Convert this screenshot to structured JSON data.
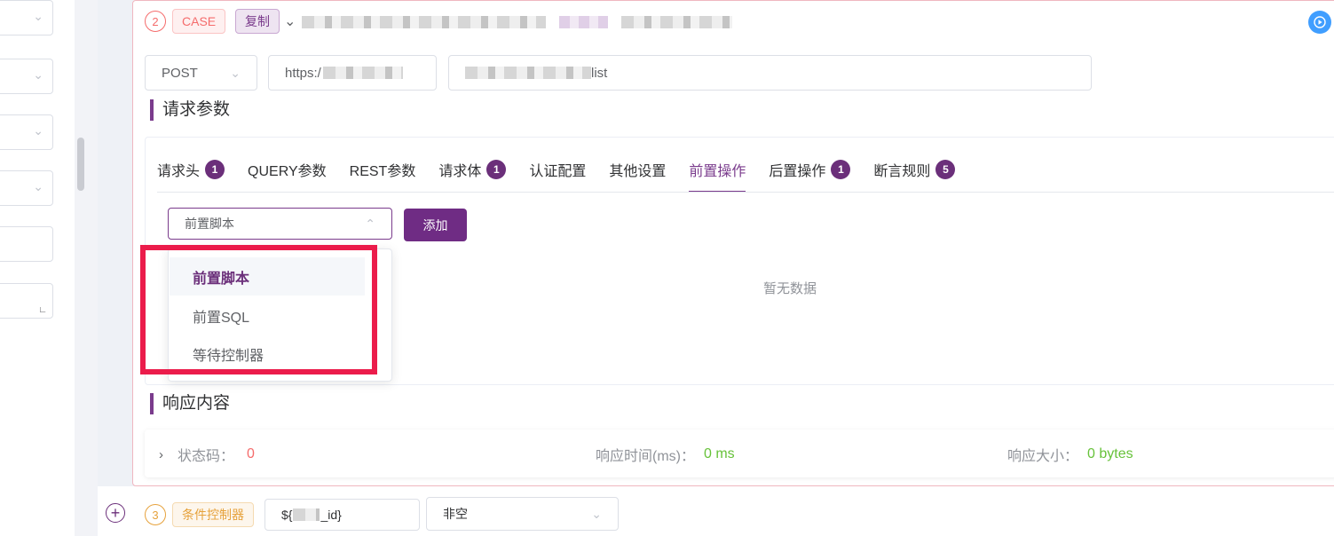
{
  "step2": {
    "number": "2",
    "type_tag": "CASE",
    "copy_tag": "复制",
    "method": "POST",
    "url_prefix": "https:/",
    "url_path_suffix": "list"
  },
  "request": {
    "section_title": "请求参数",
    "tabs": [
      {
        "label": "请求头",
        "badge": "1"
      },
      {
        "label": "QUERY参数",
        "badge": ""
      },
      {
        "label": "REST参数",
        "badge": ""
      },
      {
        "label": "请求体",
        "badge": "1"
      },
      {
        "label": "认证配置",
        "badge": ""
      },
      {
        "label": "其他设置",
        "badge": ""
      },
      {
        "label": "前置操作",
        "badge": ""
      },
      {
        "label": "后置操作",
        "badge": "1"
      },
      {
        "label": "断言规则",
        "badge": "5"
      }
    ],
    "pre_select_value": "前置脚本",
    "add_button": "添加",
    "empty_text": "暂无数据",
    "dropdown_options": [
      "前置脚本",
      "前置SQL",
      "等待控制器"
    ]
  },
  "response": {
    "section_title": "响应内容",
    "status_label": "状态码：",
    "status_value": "0",
    "time_label": "响应时间(ms)：",
    "time_value": "0 ms",
    "size_label": "响应大小：",
    "size_value": "0 bytes"
  },
  "step3": {
    "number": "3",
    "type_tag": "条件控制器",
    "expr_prefix": "${",
    "expr_suffix": "_id}",
    "operator": "非空"
  },
  "colors": {
    "accent": "#6f2c84",
    "highlight": "#eb1c4b",
    "case_red": "#f56c6c",
    "success_green": "#67c23a",
    "run_blue": "#409eff"
  }
}
